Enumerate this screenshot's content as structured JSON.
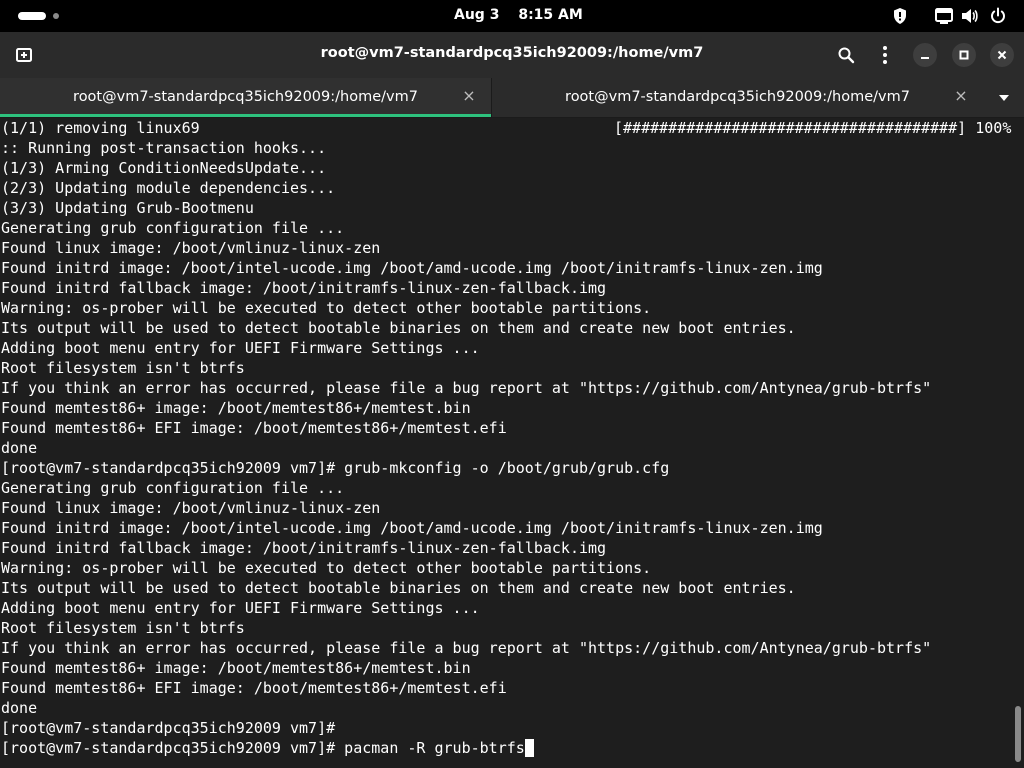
{
  "system_bar": {
    "date": "Aug 3",
    "time": "8:15 AM"
  },
  "window": {
    "title": "root@vm7-standardpcq35ich92009:/home/vm7"
  },
  "tabs": [
    {
      "label": "root@vm7-standardpcq35ich92009:/home/vm7",
      "close": "×",
      "active": true
    },
    {
      "label": "root@vm7-standardpcq35ich92009:/home/vm7",
      "close": "×",
      "active": false
    }
  ],
  "terminal": {
    "progress": {
      "bar": "[#####################################]",
      "percent": "100%"
    },
    "lines": [
      "(1/1) removing linux69",
      ":: Running post-transaction hooks...",
      "(1/3) Arming ConditionNeedsUpdate...",
      "(2/3) Updating module dependencies...",
      "(3/3) Updating Grub-Bootmenu",
      "Generating grub configuration file ...",
      "Found linux image: /boot/vmlinuz-linux-zen",
      "Found initrd image: /boot/intel-ucode.img /boot/amd-ucode.img /boot/initramfs-linux-zen.img",
      "Found initrd fallback image: /boot/initramfs-linux-zen-fallback.img",
      "Warning: os-prober will be executed to detect other bootable partitions.",
      "Its output will be used to detect bootable binaries on them and create new boot entries.",
      "Adding boot menu entry for UEFI Firmware Settings ...",
      "Root filesystem isn't btrfs",
      "If you think an error has occurred, please file a bug report at \"https://github.com/Antynea/grub-btrfs\"",
      "Found memtest86+ image: /boot/memtest86+/memtest.bin",
      "Found memtest86+ EFI image: /boot/memtest86+/memtest.efi",
      "done",
      "[root@vm7-standardpcq35ich92009 vm7]# grub-mkconfig -o /boot/grub/grub.cfg",
      "Generating grub configuration file ...",
      "Found linux image: /boot/vmlinuz-linux-zen",
      "Found initrd image: /boot/intel-ucode.img /boot/amd-ucode.img /boot/initramfs-linux-zen.img",
      "Found initrd fallback image: /boot/initramfs-linux-zen-fallback.img",
      "Warning: os-prober will be executed to detect other bootable partitions.",
      "Its output will be used to detect bootable binaries on them and create new boot entries.",
      "Adding boot menu entry for UEFI Firmware Settings ...",
      "Root filesystem isn't btrfs",
      "If you think an error has occurred, please file a bug report at \"https://github.com/Antynea/grub-btrfs\"",
      "Found memtest86+ image: /boot/memtest86+/memtest.bin",
      "Found memtest86+ EFI image: /boot/memtest86+/memtest.efi",
      "done",
      "[root@vm7-standardpcq35ich92009 vm7]#",
      "[root@vm7-standardpcq35ich92009 vm7]# pacman -R grub-btrfs"
    ]
  }
}
